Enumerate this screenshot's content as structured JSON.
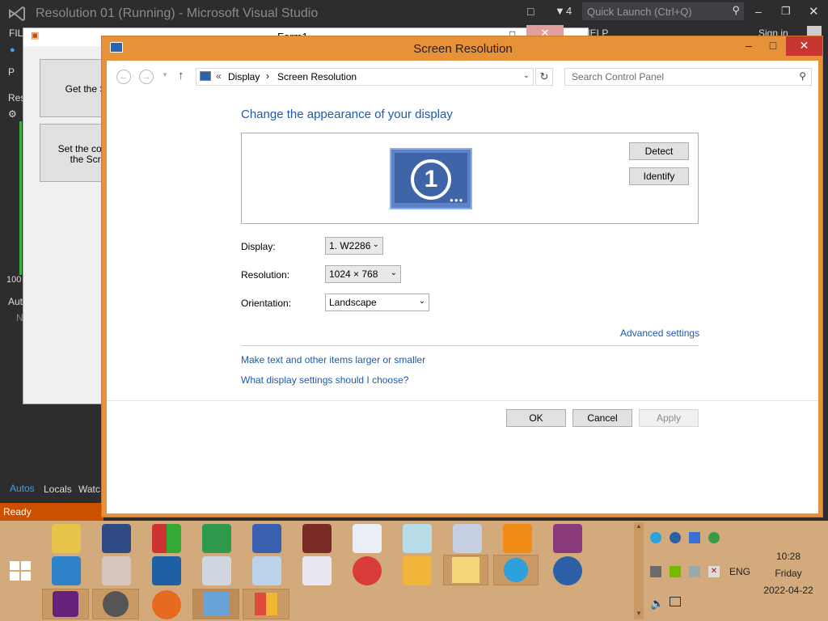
{
  "vs": {
    "title": "Resolution 01 (Running) - Microsoft Visual Studio",
    "notifications": "4",
    "quick_launch": "Quick Launch (Ctrl+Q)",
    "menu_file": "FIL",
    "menu_help": "HELP",
    "sign_in": "Sign in",
    "left_res": "Res",
    "left_100": "100",
    "left_aut": "Aut",
    "left_n": "N",
    "tab_autos": "Autos",
    "tab_locals": "Locals",
    "tab_watch": "Watc",
    "status": "Ready",
    "left_p": "P"
  },
  "form1": {
    "title": "Form1",
    "btn1": "Get the Sc",
    "btn2_line1": "Set the contro",
    "btn2_line2": "the Scre"
  },
  "dialog": {
    "title": "Screen Resolution",
    "breadcrumb": {
      "prefix": "«",
      "item1": "Display",
      "sep": "›",
      "item2": "Screen Resolution"
    },
    "search_placeholder": "Search Control Panel",
    "heading": "Change the appearance of your display",
    "monitor_number": "1",
    "detect": "Detect",
    "identify": "Identify",
    "display_label": "Display:",
    "display_value": "1. W2286",
    "resolution_label": "Resolution:",
    "resolution_value": "1024 × 768",
    "orientation_label": "Orientation:",
    "orientation_value": "Landscape",
    "advanced": "Advanced settings",
    "link1": "Make text and other items larger or smaller",
    "link2": "What display settings should I choose?",
    "ok": "OK",
    "cancel": "Cancel",
    "apply": "Apply"
  },
  "tray": {
    "lang": "ENG",
    "time": "10:28",
    "day": "Friday",
    "date": "2022-04-22"
  },
  "colors": {
    "dialog_frame": "#e79138",
    "taskbar": "#d2aa7c",
    "link": "#1e5aa8",
    "vs_status": "#ca5100"
  }
}
